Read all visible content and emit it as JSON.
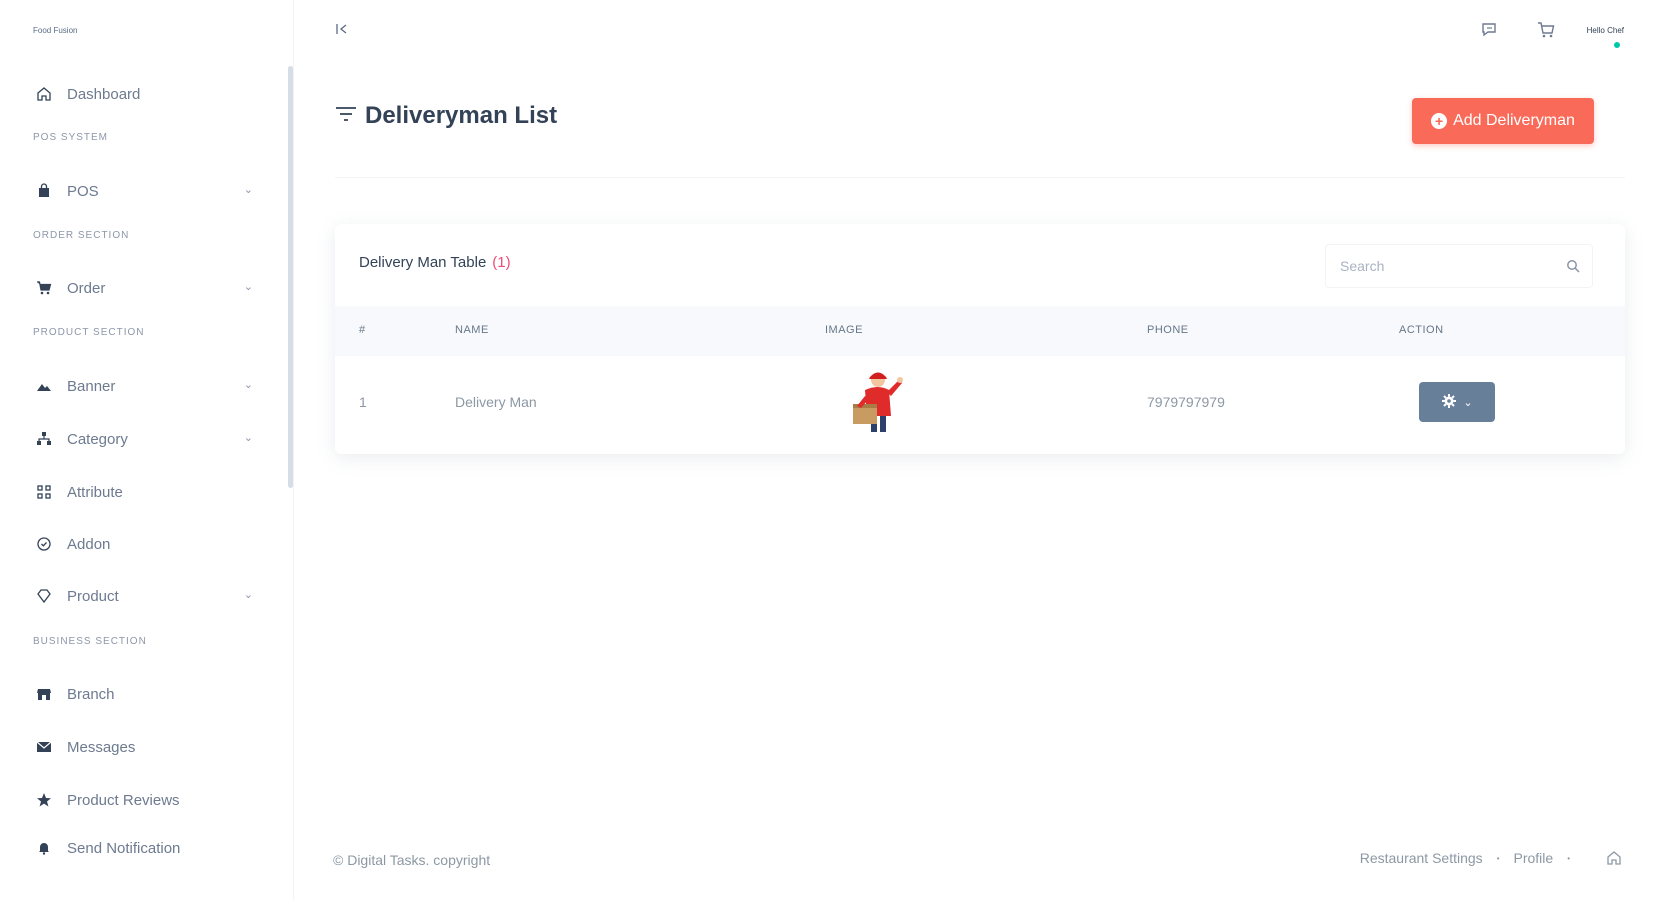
{
  "sidebar": {
    "brand": "Food Fusion",
    "items": [
      {
        "label": "Dashboard",
        "icon": "home-icon"
      },
      {
        "section": "POS SYSTEM"
      },
      {
        "label": "POS",
        "icon": "bag-icon",
        "chevron": true
      },
      {
        "section": "ORDER SECTION"
      },
      {
        "label": "Order",
        "icon": "cart-icon",
        "chevron": true
      },
      {
        "section": "PRODUCT SECTION"
      },
      {
        "label": "Banner",
        "icon": "image-icon",
        "chevron": true
      },
      {
        "label": "Category",
        "icon": "category-icon",
        "chevron": true
      },
      {
        "label": "Attribute",
        "icon": "attribute-icon"
      },
      {
        "label": "Addon",
        "icon": "addon-icon"
      },
      {
        "label": "Product",
        "icon": "diamond-icon",
        "chevron": true
      },
      {
        "section": "BUSINESS SECTION"
      },
      {
        "label": "Branch",
        "icon": "store-icon"
      },
      {
        "label": "Messages",
        "icon": "messages-icon"
      },
      {
        "label": "Product Reviews",
        "icon": "star-icon"
      },
      {
        "label": "Send Notification",
        "icon": "bell-icon"
      }
    ]
  },
  "header": {
    "username": "Hello Chef"
  },
  "page": {
    "title": "Deliveryman List",
    "add_button": "Add Deliveryman"
  },
  "table": {
    "title": "Delivery Man Table",
    "count": "(1)",
    "search_placeholder": "Search",
    "columns": [
      "#",
      "NAME",
      "IMAGE",
      "PHONE",
      "ACTION"
    ],
    "rows": [
      {
        "index": "1",
        "name": "Delivery Man",
        "phone": "7979797979"
      }
    ]
  },
  "footer": {
    "copyright": "© Digital Tasks. copyright",
    "links": [
      "Restaurant Settings",
      "Profile"
    ]
  },
  "colors": {
    "accent": "#f96a59",
    "action": "#677f99",
    "text": "#334257"
  }
}
